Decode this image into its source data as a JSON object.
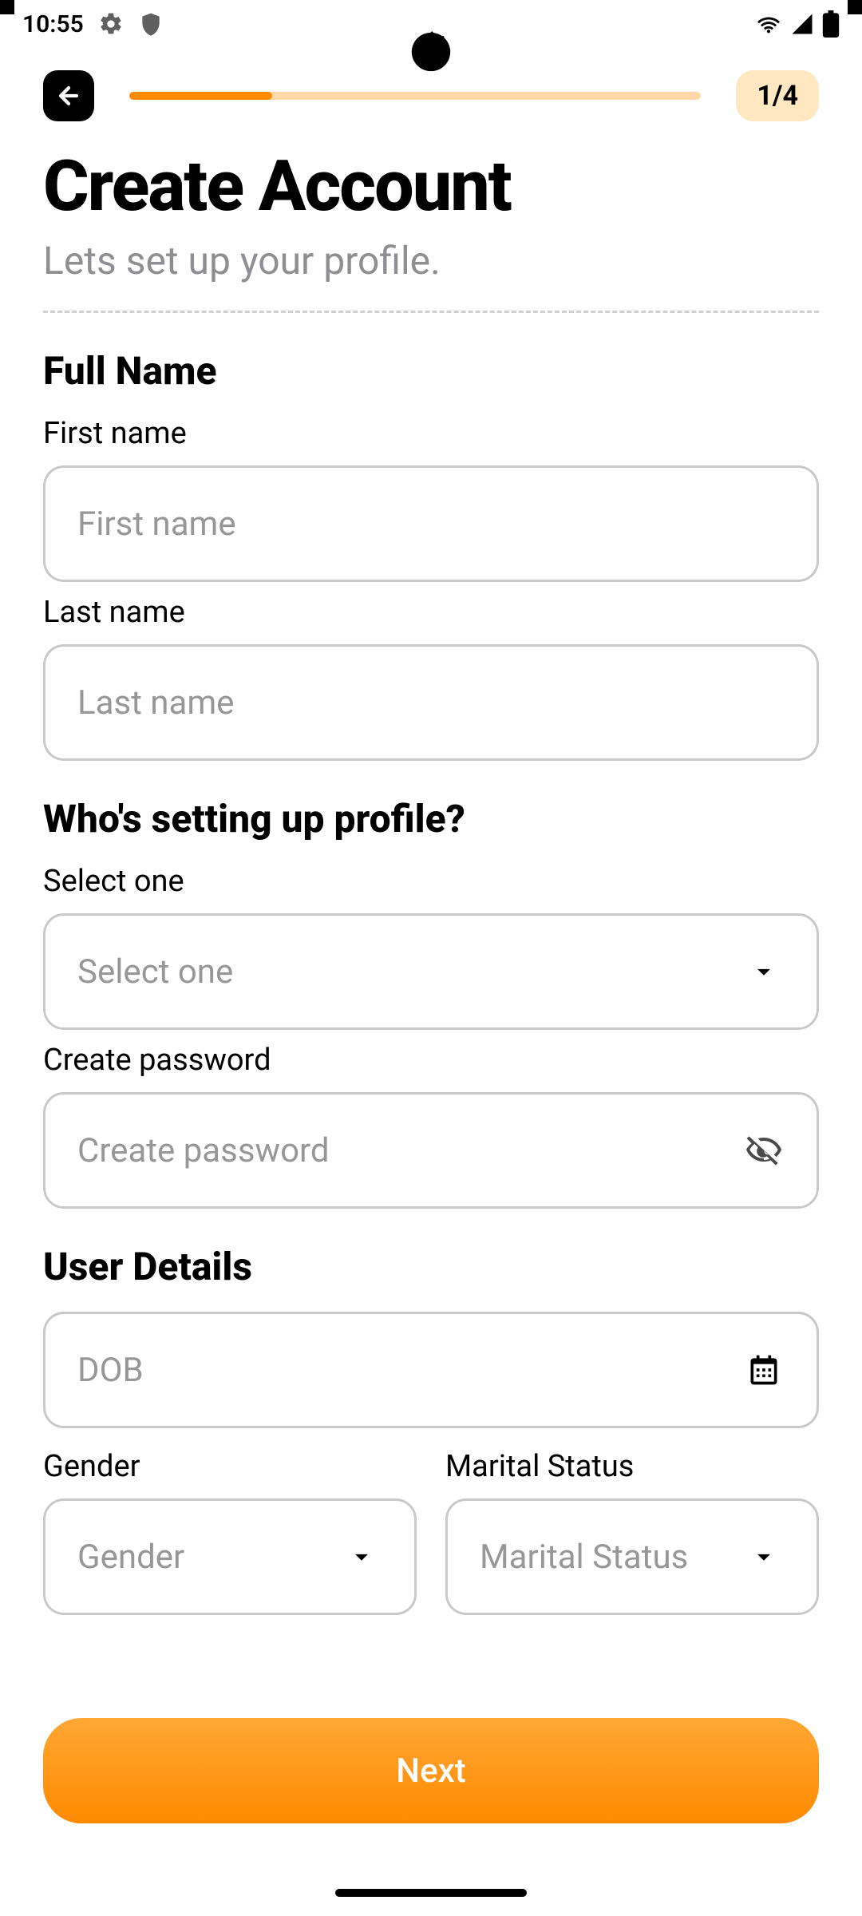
{
  "status": {
    "time": "10:55"
  },
  "header": {
    "step_badge": "1/4",
    "progress_percent": 25
  },
  "hero": {
    "title": "Create Account",
    "subtitle": "Lets set up your profile."
  },
  "sections": {
    "full_name": {
      "title": "Full Name",
      "first_name_label": "First name",
      "first_name_placeholder": "First name",
      "last_name_label": "Last name",
      "last_name_placeholder": "Last name"
    },
    "who": {
      "title": "Who's setting up profile?",
      "select_label": "Select one",
      "select_placeholder": "Select one",
      "password_label": "Create password",
      "password_placeholder": "Create password"
    },
    "user_details": {
      "title": "User Details",
      "dob_placeholder": "DOB",
      "gender_label": "Gender",
      "gender_placeholder": "Gender",
      "marital_label": "Marital Status",
      "marital_placeholder": "Marital Status"
    }
  },
  "footer": {
    "next_label": "Next"
  }
}
